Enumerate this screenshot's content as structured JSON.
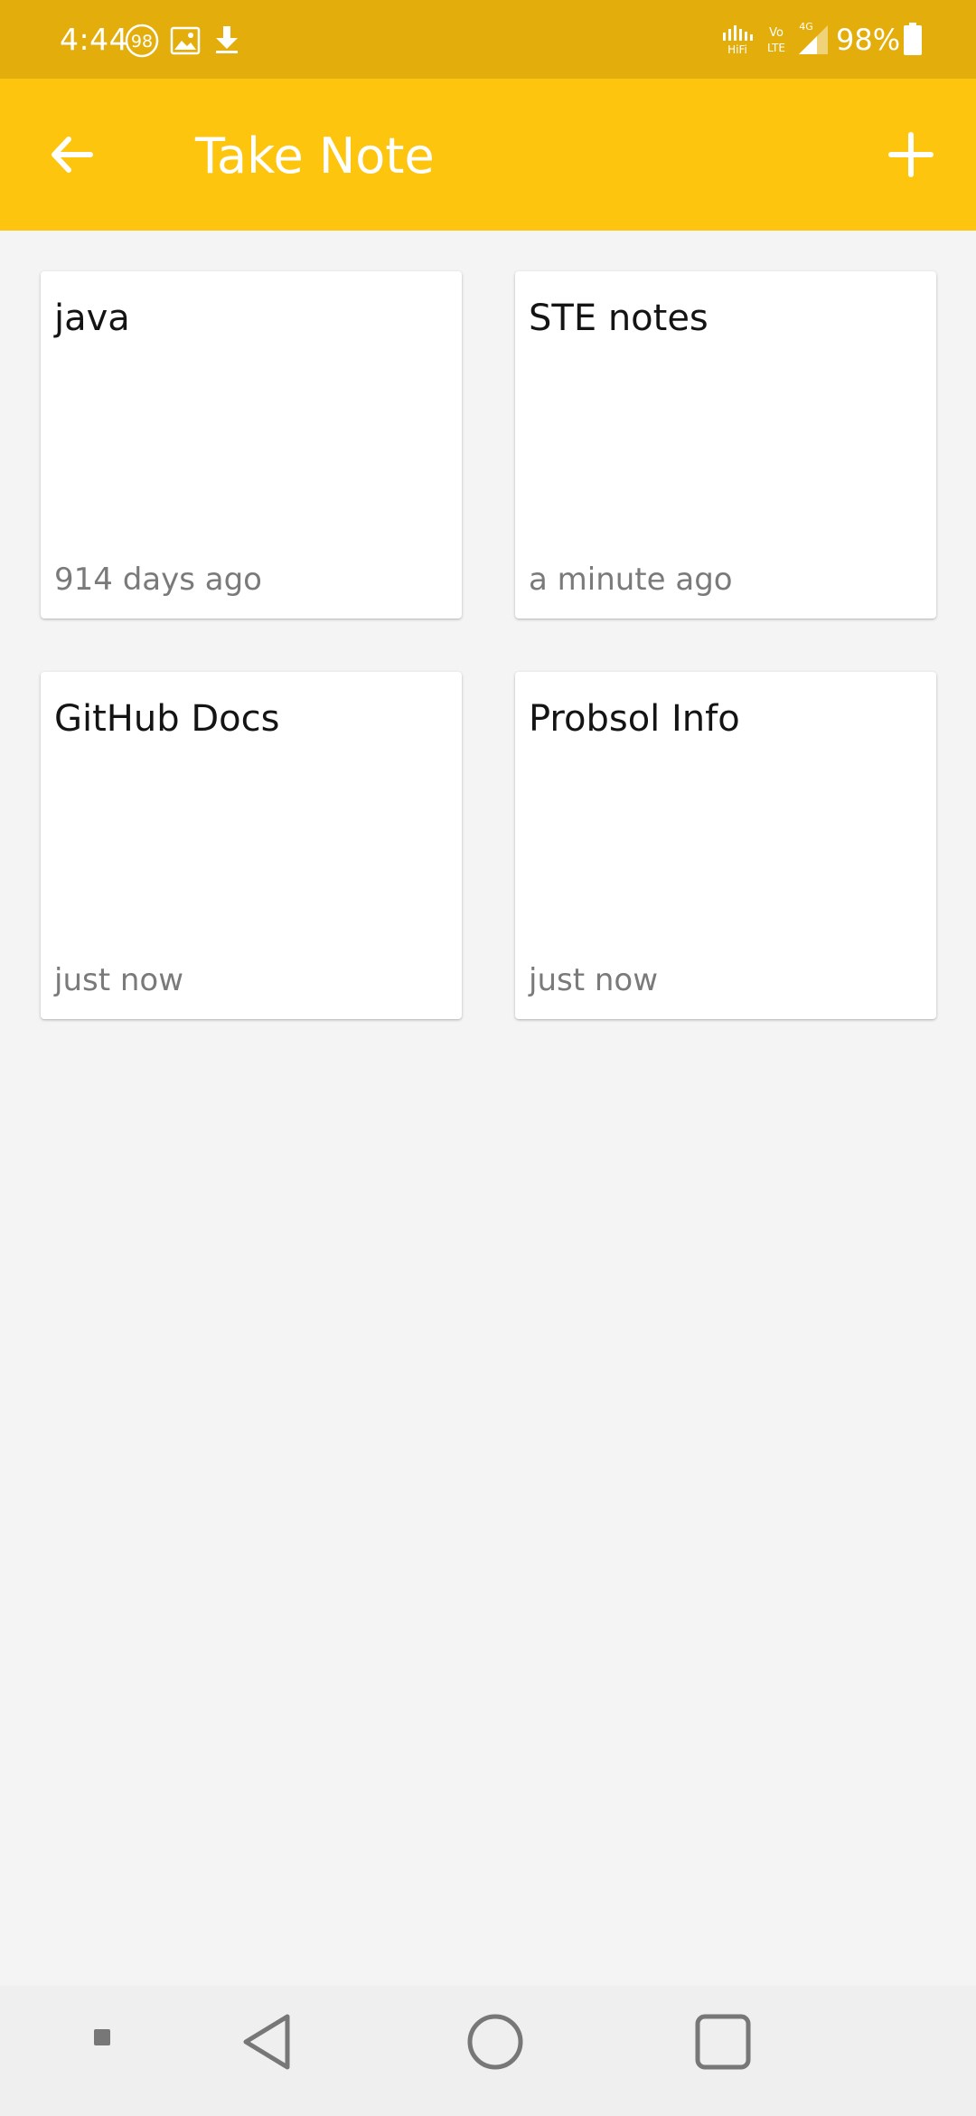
{
  "status_bar": {
    "time": "4:44",
    "notification_badge": "98",
    "battery_percent": "98%",
    "icons": [
      "circled-98-icon",
      "gallery-icon",
      "download-icon",
      "hifi-signal-icon",
      "volte-icon",
      "cellular-4g-icon",
      "battery-icon"
    ],
    "hifi_label": "HiFi",
    "volte_label_top": "Vo",
    "volte_label_bottom": "LTE",
    "network_label": "4G"
  },
  "app_bar": {
    "title": "Take Note",
    "back_icon": "arrow-back-icon",
    "add_icon": "plus-icon",
    "background_color": "#fec50f"
  },
  "notes": [
    {
      "title": "java",
      "time": "914 days ago"
    },
    {
      "title": "STE notes",
      "time": "a minute ago"
    },
    {
      "title": "GitHub Docs",
      "time": "just now"
    },
    {
      "title": "Probsol Info",
      "time": "just now"
    }
  ],
  "nav_bar": {
    "icons": [
      "small-square-icon",
      "back-triangle-icon",
      "home-circle-icon",
      "recents-square-icon"
    ]
  },
  "colors": {
    "status_bar": "#e3ae0b",
    "app_bar": "#fec50f",
    "background": "#f4f4f4",
    "card": "#ffffff",
    "muted_text": "#7a7a7a"
  }
}
